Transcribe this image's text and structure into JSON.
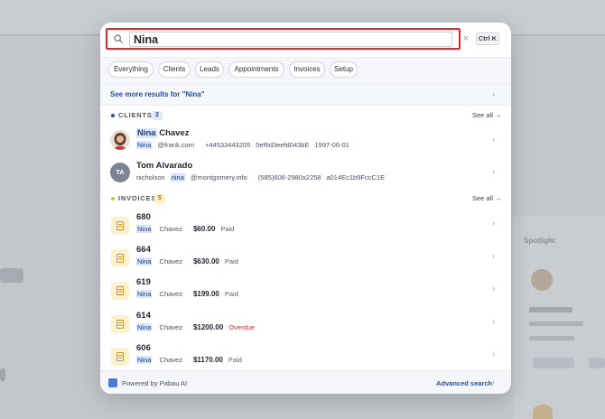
{
  "search": {
    "query": "Nina",
    "clear_label": "×",
    "shortcut": "Ctrl K"
  },
  "filters": [
    "Everything",
    "Clients",
    "Leads",
    "Appointments",
    "Invoices",
    "Setup"
  ],
  "see_more": "See more results for \"Nina\"",
  "clients": {
    "label": "CLIENTS",
    "count": "2",
    "see_all": "See all →",
    "items": [
      {
        "first": "Nina",
        "last": " Chavez",
        "email_hl": "Nina",
        "email_rest": "@frank.com",
        "phone": "+44533443205",
        "id": "5ef6d3eefd043bE",
        "dob": "1997-06-01"
      },
      {
        "initials": "TA",
        "name": "Tom Alvarado",
        "email_pre": "nicholson",
        "email_hl": "nina",
        "email_rest": "@montgomery.info",
        "phone": "(585)606-2980x2258",
        "id": "a014Ec1b9FccC1E"
      }
    ]
  },
  "invoices": {
    "label": "INVOICES",
    "count": "5",
    "see_all": "See all →",
    "items": [
      {
        "number": "680",
        "first": "Nina",
        "last": " Chavez",
        "amount": "$60.00",
        "status": "Paid"
      },
      {
        "number": "664",
        "first": "Nina",
        "last": " Chavez",
        "amount": "$630.00",
        "status": "Paid"
      },
      {
        "number": "619",
        "first": "Nina",
        "last": " Chavez",
        "amount": "$199.00",
        "status": "Paid"
      },
      {
        "number": "614",
        "first": "Nina",
        "last": " Chavez",
        "amount": "$1200.00",
        "status": "Overdue"
      },
      {
        "number": "606",
        "first": "Nina",
        "last": " Chavez",
        "amount": "$1170.00",
        "status": "Paid"
      }
    ]
  },
  "footer": {
    "powered": "Powered by Pabau AI",
    "advanced": "Advanced search"
  },
  "background": {
    "panel_title": "Spotlight"
  },
  "colors": {
    "highlight_border": "#e5262d",
    "accent": "#2a4f9a",
    "overdue": "#c8322f",
    "invoice_bg": "#fbf0cf"
  }
}
